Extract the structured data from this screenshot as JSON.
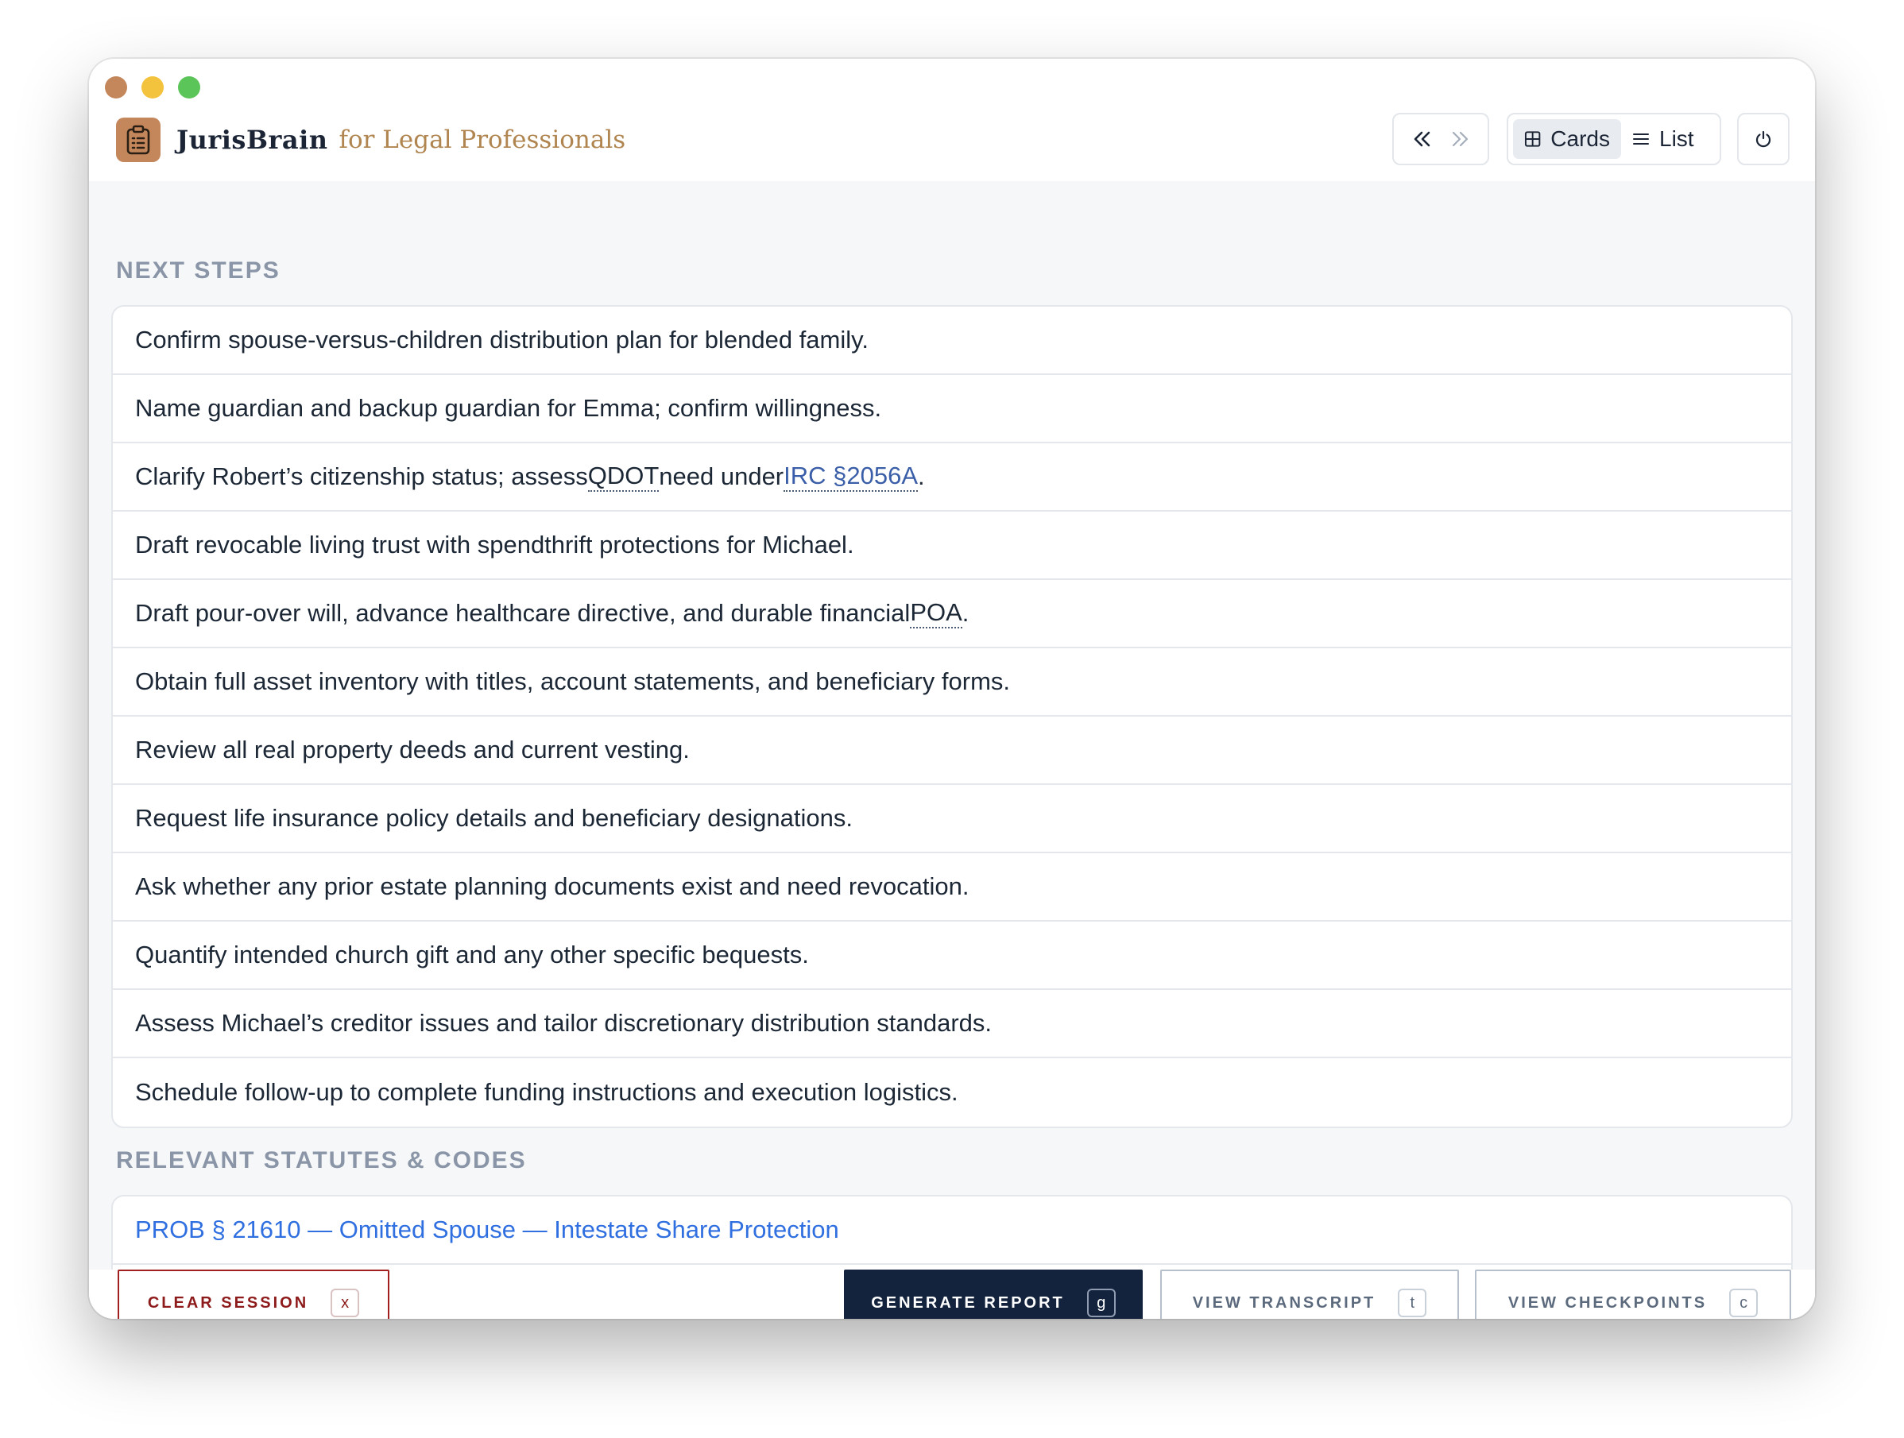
{
  "app": {
    "name": "JurisBrain",
    "tagline": "for Legal Professionals",
    "logo_icon": "clipboard-icon"
  },
  "toolbar": {
    "back_icon": "chevrons-left-icon",
    "forward_icon": "chevrons-right-icon",
    "view_cards_label": "Cards",
    "view_list_label": "List",
    "active_view": "Cards",
    "power_icon": "power-icon"
  },
  "next_steps": {
    "heading": "NEXT STEPS",
    "items": [
      {
        "pre": "Confirm spouse-versus-children distribution plan for blended family."
      },
      {
        "pre": "Name guardian and backup guardian for Emma; confirm willingness."
      },
      {
        "pre": "Clarify Robert’s citizenship status; assess ",
        "abbr1": "QDOT",
        "mid": " need under ",
        "abbr2": "IRC §2056A",
        "post": "."
      },
      {
        "pre": "Draft revocable living trust with spendthrift protections for Michael."
      },
      {
        "pre": "Draft pour-over will, advance healthcare directive, and durable financial ",
        "abbr1": "POA",
        "post": "."
      },
      {
        "pre": "Obtain full asset inventory with titles, account statements, and beneficiary forms."
      },
      {
        "pre": "Review all real property deeds and current vesting."
      },
      {
        "pre": "Request life insurance policy details and beneficiary designations."
      },
      {
        "pre": "Ask whether any prior estate planning documents exist and need revocation."
      },
      {
        "pre": "Quantify intended church gift and any other specific bequests."
      },
      {
        "pre": "Assess Michael’s creditor issues and tailor discretionary distribution standards."
      },
      {
        "pre": "Schedule follow-up to complete funding instructions and execution logistics."
      }
    ]
  },
  "statutes": {
    "heading": "RELEVANT STATUTES & CODES",
    "items": [
      {
        "label": "PROB § 21610 — Omitted Spouse — Intestate Share Protection"
      }
    ]
  },
  "footer": {
    "clear": {
      "label": "CLEAR SESSION",
      "key": "x"
    },
    "generate": {
      "label": "GENERATE REPORT",
      "key": "g"
    },
    "transcript": {
      "label": "VIEW TRANSCRIPT",
      "key": "t"
    },
    "checkpoints": {
      "label": "VIEW CHECKPOINTS",
      "key": "c"
    }
  },
  "colors": {
    "accent_gold": "#c4875c",
    "link_blue": "#2f6fe0",
    "primary_navy": "#13233d",
    "danger_red": "#a11f1f"
  }
}
